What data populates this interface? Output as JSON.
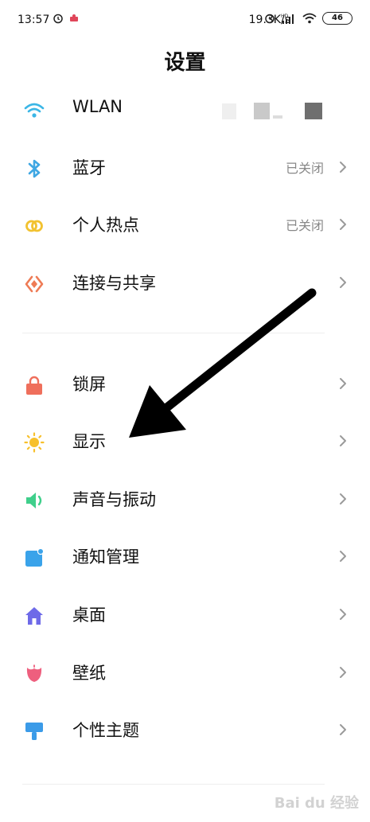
{
  "status_bar": {
    "time": "13:57",
    "net_speed": "19.3K/s",
    "network_type": "HD",
    "battery": "46"
  },
  "page": {
    "title": "设置"
  },
  "groups": [
    {
      "items": [
        {
          "label": "WLAN",
          "icon": "wifi-icon",
          "value": ""
        },
        {
          "label": "蓝牙",
          "icon": "bluetooth-icon",
          "value": "已关闭"
        },
        {
          "label": "个人热点",
          "icon": "hotspot-icon",
          "value": "已关闭"
        },
        {
          "label": "连接与共享",
          "icon": "connection-share-icon",
          "value": ""
        }
      ]
    },
    {
      "items": [
        {
          "label": "锁屏",
          "icon": "lock-icon",
          "value": ""
        },
        {
          "label": "显示",
          "icon": "sun-icon",
          "value": ""
        },
        {
          "label": "声音与振动",
          "icon": "speaker-icon",
          "value": ""
        },
        {
          "label": "通知管理",
          "icon": "notification-icon",
          "value": ""
        },
        {
          "label": "桌面",
          "icon": "home-icon",
          "value": ""
        },
        {
          "label": "壁纸",
          "icon": "tulip-icon",
          "value": ""
        },
        {
          "label": "个性主题",
          "icon": "theme-brush-icon",
          "value": ""
        }
      ]
    }
  ],
  "watermark": "Bai du 经验",
  "colors": {
    "wifi": "#3bb6e6",
    "bluetooth": "#3fa7e3",
    "hotspot": "#f2c230",
    "connection": "#ee7b55",
    "lock": "#ef6f5c",
    "sun": "#f7c02c",
    "speaker": "#3fcf8b",
    "notification": "#3aa3ea",
    "home": "#6e6ae8",
    "tulip": "#ee5f7e",
    "theme": "#3b9be8"
  }
}
